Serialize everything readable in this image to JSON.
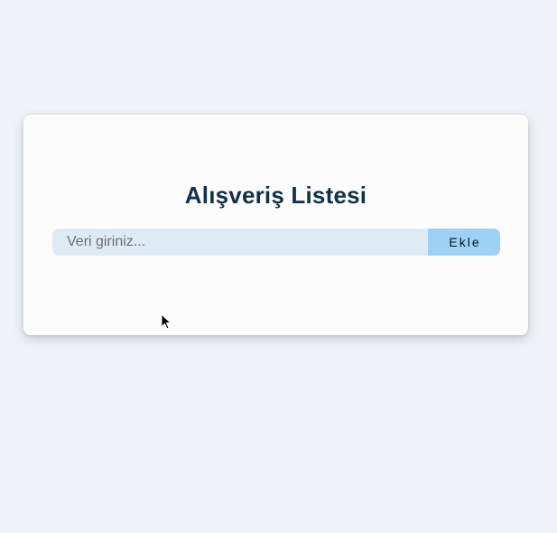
{
  "app": {
    "title": "Alışveriş Listesi"
  },
  "form": {
    "input_value": "",
    "input_placeholder": "Veri giriniz...",
    "add_button_label": "Ekle"
  },
  "colors": {
    "page_background": "#eff2f6",
    "card_background": "#fdfcfd",
    "title_color": "#123046",
    "input_background": "#deebf5",
    "button_background": "#9dd2f6"
  },
  "icons": {
    "cursor": "mouse-pointer-icon"
  }
}
